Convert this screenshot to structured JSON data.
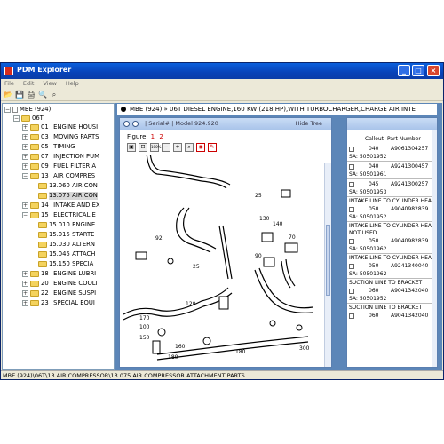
{
  "window": {
    "title": "PDM Explorer",
    "buttons": {
      "minimize": "_",
      "maximize": "□",
      "close": "×"
    }
  },
  "menu": [
    "File",
    "Edit",
    "View",
    "Help"
  ],
  "toolbar_icons": [
    "open-icon",
    "save-icon",
    "print-icon",
    "find-icon",
    "zoom-icon"
  ],
  "tree": {
    "root": "MBE (924)",
    "model": "06T",
    "items": [
      {
        "num": "01",
        "label": "ENGINE HOUSI"
      },
      {
        "num": "03",
        "label": "MOVING PARTS"
      },
      {
        "num": "05",
        "label": "TIMING"
      },
      {
        "num": "07",
        "label": "INJECTION PUM"
      },
      {
        "num": "09",
        "label": "FUEL FILTER A"
      },
      {
        "num": "13",
        "label": "AIR COMPRES"
      },
      {
        "num": "13.060",
        "label": "AIR CON"
      },
      {
        "num": "13.075",
        "label": "AIR CON"
      },
      {
        "num": "14",
        "label": "INTAKE AND EX"
      },
      {
        "num": "15",
        "label": "ELECTRICAL E"
      },
      {
        "num": "15.010",
        "label": "ENGINE"
      },
      {
        "num": "15.015",
        "label": "STARTE"
      },
      {
        "num": "15.030",
        "label": "ALTERN"
      },
      {
        "num": "15.045",
        "label": "ATTACH"
      },
      {
        "num": "15.150",
        "label": "SPECIA"
      },
      {
        "num": "18",
        "label": "ENGINE LUBRI"
      },
      {
        "num": "20",
        "label": "ENGINE COOLI"
      },
      {
        "num": "22",
        "label": "ENGINE SUSPI"
      },
      {
        "num": "23",
        "label": "SPECIAL EQUI"
      }
    ]
  },
  "heading": "MBE (924) » 06T DIESEL ENGINE,160 KW (218 HP),WITH TURBOCHARGER,CHARGE AIR INTE",
  "figure": {
    "info": "| Serial# | Model 924.920",
    "hide_tree": "Hide Tree",
    "label": "Figure",
    "pages": [
      "1",
      "2"
    ],
    "tools": [
      "fit-icon",
      "fit-width-icon",
      "100%",
      "zoom-out-icon",
      "zoom-in-icon",
      "zoom-window-icon",
      "callout-icon",
      "highlight-icon"
    ],
    "callouts": [
      "25",
      "130",
      "140",
      "92",
      "25",
      "90",
      "70",
      "120",
      "170",
      "100",
      "150",
      "160",
      "180",
      "180",
      "300"
    ]
  },
  "parts": {
    "headers": {
      "callout": "Callout",
      "part_number": "Part Number"
    },
    "rows": [
      {
        "callout": "040",
        "part": "A9061304257",
        "sa": "SA:  50501952",
        "desc": ""
      },
      {
        "callout": "040",
        "part": "A9241300457",
        "sa": "SA:  50501961",
        "desc": ""
      },
      {
        "callout": "045",
        "part": "A9241300257",
        "sa": "SA:  50501953",
        "desc": ""
      },
      {
        "callout": "050",
        "part": "A9040982839",
        "sa": "SA:  50501952",
        "desc": "INTAKE LINE TO CYLINDER HEAD"
      },
      {
        "callout": "050",
        "part": "A9040982839",
        "sa": "SA:  50501962",
        "desc": "INTAKE LINE TO CYLINDER HEAD NOT USED"
      },
      {
        "callout": "050",
        "part": "A9241340040",
        "sa": "SA:  50501962",
        "desc": "INTAKE LINE TO CYLINDER HEAD"
      },
      {
        "callout": "060",
        "part": "A9041342040",
        "sa": "SA:  50501952",
        "desc": "SUCTION LINE TO BRACKET"
      },
      {
        "callout": "060",
        "part": "A9041342040",
        "sa": "",
        "desc": "SUCTION LINE TO BRACKET"
      }
    ]
  },
  "status": "MBE (924)\\06T\\13  AIR COMPRESSOR\\13.075  AIR COMPRESSOR ATTACHMENT PARTS"
}
